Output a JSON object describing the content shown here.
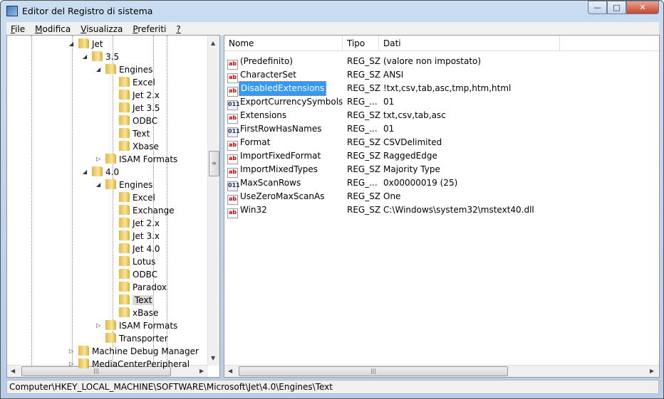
{
  "window": {
    "title": "Editor del Registro di sistema",
    "minimize": "0",
    "maximize": "1",
    "close": "r"
  },
  "menu": [
    {
      "key": "F",
      "rest": "ile"
    },
    {
      "key": "M",
      "rest": "odifica"
    },
    {
      "key": "V",
      "rest": "isualizza"
    },
    {
      "key": "P",
      "rest": "referiti"
    },
    {
      "key": "?",
      "rest": ""
    }
  ],
  "tree": [
    {
      "label": "Jet",
      "level": 0,
      "exp": "open"
    },
    {
      "label": "3.5",
      "level": 1,
      "exp": "open"
    },
    {
      "label": "Engines",
      "level": 2,
      "exp": "open"
    },
    {
      "label": "Excel",
      "level": 3,
      "exp": ""
    },
    {
      "label": "Jet 2.x",
      "level": 3,
      "exp": ""
    },
    {
      "label": "Jet 3.5",
      "level": 3,
      "exp": ""
    },
    {
      "label": "ODBC",
      "level": 3,
      "exp": ""
    },
    {
      "label": "Text",
      "level": 3,
      "exp": ""
    },
    {
      "label": "Xbase",
      "level": 3,
      "exp": ""
    },
    {
      "label": "ISAM Formats",
      "level": 2,
      "exp": "closed"
    },
    {
      "label": "4.0",
      "level": 1,
      "exp": "open"
    },
    {
      "label": "Engines",
      "level": 2,
      "exp": "open"
    },
    {
      "label": "Excel",
      "level": 3,
      "exp": ""
    },
    {
      "label": "Exchange",
      "level": 3,
      "exp": ""
    },
    {
      "label": "Jet 2.x",
      "level": 3,
      "exp": ""
    },
    {
      "label": "Jet 3.x",
      "level": 3,
      "exp": ""
    },
    {
      "label": "Jet 4.0",
      "level": 3,
      "exp": ""
    },
    {
      "label": "Lotus",
      "level": 3,
      "exp": ""
    },
    {
      "label": "ODBC",
      "level": 3,
      "exp": ""
    },
    {
      "label": "Paradox",
      "level": 3,
      "exp": ""
    },
    {
      "label": "Text",
      "level": 3,
      "exp": "",
      "selected": true
    },
    {
      "label": "xBase",
      "level": 3,
      "exp": ""
    },
    {
      "label": "ISAM Formats",
      "level": 2,
      "exp": "closed"
    },
    {
      "label": "Transporter",
      "level": 2,
      "exp": ""
    },
    {
      "label": "Machine Debug Manager",
      "level": 0,
      "exp": "closed"
    },
    {
      "label": "MediaCenterPeripheral",
      "level": 0,
      "exp": "closed"
    }
  ],
  "columns": {
    "name": "Nome",
    "type": "Tipo",
    "data": "Dati"
  },
  "values": [
    {
      "name": "(Predefinito)",
      "type": "REG_SZ",
      "data": "(valore non impostato)",
      "icon": "sz"
    },
    {
      "name": "CharacterSet",
      "type": "REG_SZ",
      "data": "ANSI",
      "icon": "sz"
    },
    {
      "name": "DisabledExtensions",
      "type": "REG_SZ",
      "data": "!txt,csv,tab,asc,tmp,htm,html",
      "icon": "sz",
      "selected": true
    },
    {
      "name": "ExportCurrencySymbols",
      "type": "REG_...",
      "data": "01",
      "icon": "bin"
    },
    {
      "name": "Extensions",
      "type": "REG_SZ",
      "data": "txt,csv,tab,asc",
      "icon": "sz"
    },
    {
      "name": "FirstRowHasNames",
      "type": "REG_...",
      "data": "01",
      "icon": "bin"
    },
    {
      "name": "Format",
      "type": "REG_SZ",
      "data": "CSVDelimited",
      "icon": "sz"
    },
    {
      "name": "ImportFixedFormat",
      "type": "REG_SZ",
      "data": "RaggedEdge",
      "icon": "sz"
    },
    {
      "name": "ImportMixedTypes",
      "type": "REG_SZ",
      "data": "Majority Type",
      "icon": "sz"
    },
    {
      "name": "MaxScanRows",
      "type": "REG_...",
      "data": "0x00000019 (25)",
      "icon": "bin"
    },
    {
      "name": "UseZeroMaxScanAs",
      "type": "REG_SZ",
      "data": "One",
      "icon": "sz"
    },
    {
      "name": "Win32",
      "type": "REG_SZ",
      "data": "C:\\Windows\\system32\\mstext40.dll",
      "icon": "sz"
    }
  ],
  "status": "Computer\\HKEY_LOCAL_MACHINE\\SOFTWARE\\Microsoft\\Jet\\4.0\\Engines\\Text"
}
